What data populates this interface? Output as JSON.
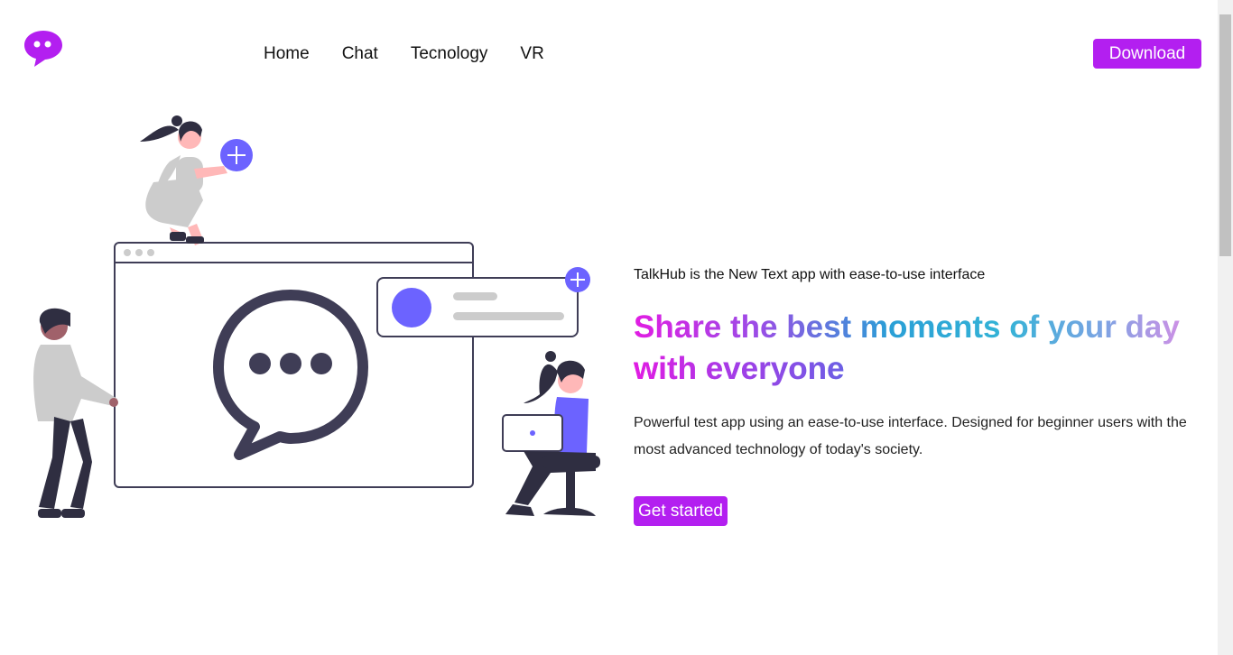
{
  "navbar": {
    "logo_icon": "chat-bubble-icon",
    "links": [
      "Home",
      "Chat",
      "Tecnology",
      "VR"
    ],
    "download_label": "Download"
  },
  "hero": {
    "tagline": "TalkHub is the New Text app with ease-to-use interface",
    "headline_line1": "Share the best moments of your day",
    "headline_line2": "with everyone",
    "description": "Powerful test app using an ease-to-use interface. Designed for beginner users with the most advanced technology of today's society.",
    "cta_label": "Get started",
    "illustration_icon": "chat-window-people-illustration"
  },
  "colors": {
    "accent": "#b31ff0",
    "illustration_purple": "#6c63ff",
    "illustration_dark": "#3f3d56"
  }
}
